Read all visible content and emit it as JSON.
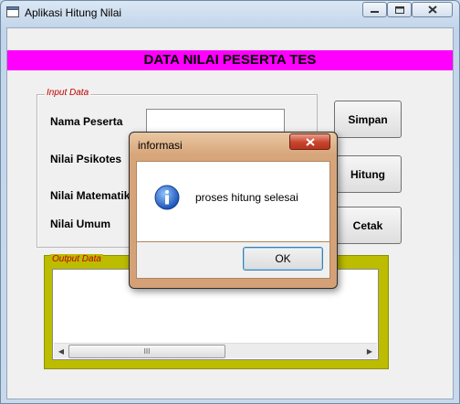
{
  "window": {
    "title": "Aplikasi Hitung Nilai",
    "minimize_icon": "minimize-icon",
    "maximize_icon": "maximize-icon",
    "close_icon": "close-icon"
  },
  "banner": {
    "text": "DATA NILAI PESERTA TES",
    "color": "#ff00ff"
  },
  "input_group": {
    "label": "Input Data",
    "fields": [
      {
        "label": "Nama Peserta",
        "value": ""
      },
      {
        "label": "Nilai Psikotes",
        "value": ""
      },
      {
        "label": "Nilai Matematika",
        "value": ""
      },
      {
        "label": "Nilai Umum",
        "value": ""
      }
    ]
  },
  "buttons": {
    "save": "Simpan",
    "compute": "Hitung",
    "print": "Cetak"
  },
  "output_group": {
    "label": "Output Data",
    "color": "#bcbc00",
    "scroll_thumb": "III"
  },
  "dialog": {
    "title": "informasi",
    "close_label": "x",
    "message": "proses hitung selesai",
    "ok_label": "OK",
    "icon": "info-icon"
  }
}
